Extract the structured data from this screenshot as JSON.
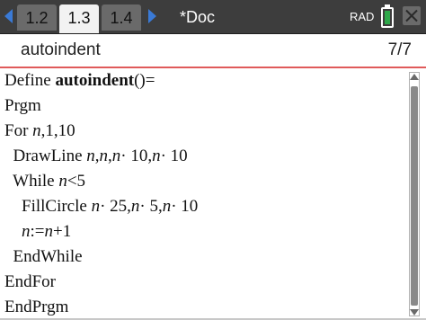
{
  "tabs": [
    {
      "label": "1.2",
      "active": false
    },
    {
      "label": "1.3",
      "active": true
    },
    {
      "label": "1.4",
      "active": false
    }
  ],
  "document": {
    "title": "*Doc"
  },
  "status": {
    "angle_mode": "RAD",
    "battery_icon": "battery-icon"
  },
  "editor": {
    "program_name": "autoindent",
    "line_position": "7/7"
  },
  "code_lines": [
    {
      "parts": [
        {
          "t": "Define "
        },
        {
          "t": "autoindent",
          "b": true
        },
        {
          "t": "()="
        }
      ]
    },
    {
      "parts": [
        {
          "t": "Prgm"
        }
      ]
    },
    {
      "parts": [
        {
          "t": "For "
        },
        {
          "t": "n",
          "i": true
        },
        {
          "t": ",1,10"
        }
      ]
    },
    {
      "parts": [
        {
          "t": "  DrawLine "
        },
        {
          "t": "n",
          "i": true
        },
        {
          "t": ","
        },
        {
          "t": "n",
          "i": true
        },
        {
          "t": ","
        },
        {
          "t": "n",
          "i": true
        },
        {
          "t": "· 10,"
        },
        {
          "t": "n",
          "i": true
        },
        {
          "t": "· 10"
        }
      ]
    },
    {
      "parts": [
        {
          "t": "  While "
        },
        {
          "t": "n",
          "i": true
        },
        {
          "t": "<5"
        }
      ]
    },
    {
      "parts": [
        {
          "t": "    FillCircle "
        },
        {
          "t": "n",
          "i": true
        },
        {
          "t": "· 25,"
        },
        {
          "t": "n",
          "i": true
        },
        {
          "t": "· 5,"
        },
        {
          "t": "n",
          "i": true
        },
        {
          "t": "· 10"
        }
      ]
    },
    {
      "parts": [
        {
          "t": "    "
        },
        {
          "t": "n",
          "i": true
        },
        {
          "t": ":="
        },
        {
          "t": "n",
          "i": true
        },
        {
          "t": "+1"
        }
      ]
    },
    {
      "parts": [
        {
          "t": "  EndWhile"
        }
      ]
    },
    {
      "parts": [
        {
          "t": "EndFor"
        }
      ]
    },
    {
      "parts": [
        {
          "t": "EndPrgm"
        }
      ]
    }
  ],
  "colors": {
    "topbar": "#3d3d3d",
    "nav_arrow": "#3a7ad6",
    "battery_fill": "#2ea84a",
    "header_rule": "#e05a5a"
  }
}
